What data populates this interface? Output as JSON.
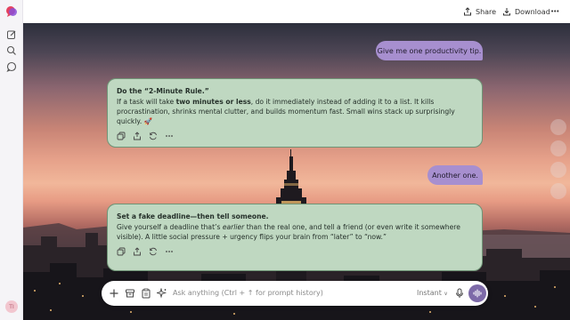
{
  "topbar": {
    "share_label": "Share",
    "download_label": "Download",
    "more_label": "•••"
  },
  "sidebar": {
    "avatar_initials": "TI",
    "icons": [
      "logo-icon",
      "new-chat-icon",
      "search-icon",
      "chat-bubble-icon"
    ]
  },
  "messages": [
    {
      "role": "user",
      "text": "Give me one productivity tip."
    },
    {
      "role": "assistant",
      "title": "Do the “2-Minute Rule.”",
      "body_pre": "If a task will take ",
      "body_bold": "two minutes or less",
      "body_post": ", do it immediately instead of adding it to a list. It kills procrastination, shrinks mental clutter, and builds momentum fast. Small wins stack up surprisingly quickly.",
      "emoji": "🚀"
    },
    {
      "role": "user",
      "text": "Another one."
    },
    {
      "role": "assistant",
      "title": "Set a fake deadline—then tell someone.",
      "body_pre": "Give yourself a deadline that’s ",
      "body_em": "earlier",
      "body_post": " than the real one, and tell a friend (or even write it somewhere visible). A little social pressure + urgency flips your brain from “later” to “now.”"
    }
  ],
  "composer": {
    "placeholder": "Ask anything (Ctrl + ↑ for prompt history)",
    "mode_label": "Instant",
    "mode_chevron": "∨"
  },
  "colors": {
    "user_bubble": "#a78fcf",
    "assistant_bubble": "#bfd8c1",
    "assistant_border": "#6f9476",
    "send_button": "#7d6aa8"
  }
}
